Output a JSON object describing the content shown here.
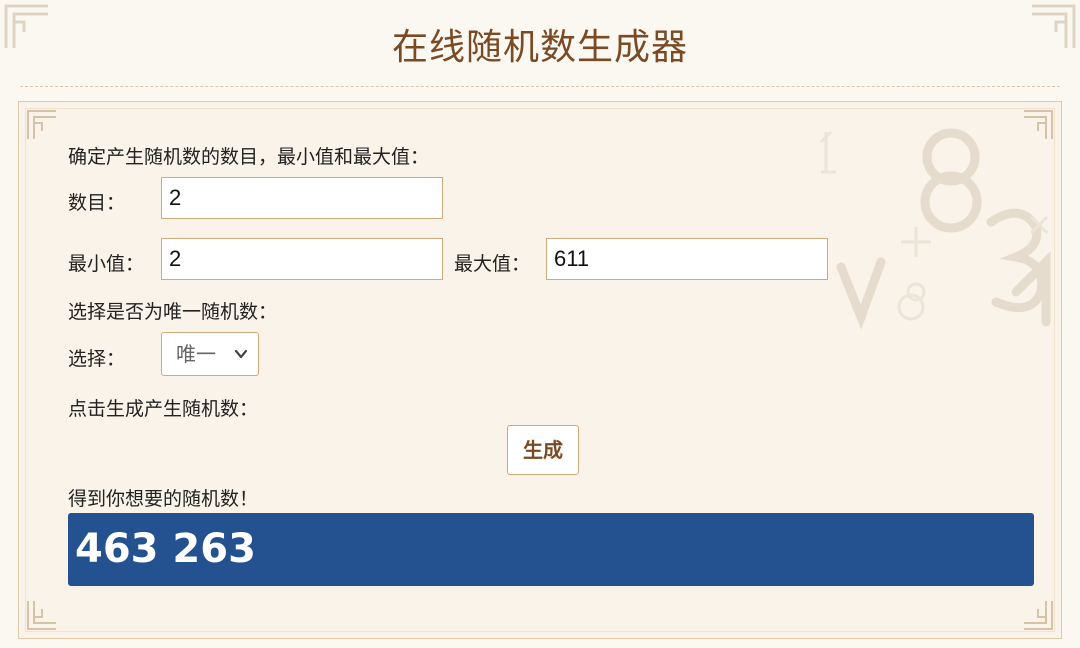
{
  "page": {
    "title": "在线随机数生成器"
  },
  "form": {
    "intro": "确定产生随机数的数目，最小值和最大值：",
    "count_label": "数目：",
    "count_value": "2",
    "min_label": "最小值：",
    "min_value": "2",
    "max_label": "最大值：",
    "max_value": "611",
    "unique_prompt": "选择是否为唯一随机数：",
    "select_label": "选择：",
    "select_value": "唯一",
    "click_prompt": "点击生成产生随机数：",
    "generate_label": "生成",
    "result_label": "得到你想要的随机数！",
    "result_value": "463 263"
  },
  "icons": {
    "select_arrow": "chevron-down-icon",
    "corner": "corner-ornament-icon",
    "background": "numbers-decoration-icon"
  },
  "colors": {
    "title": "#7a4a24",
    "border": "#d3a87c",
    "result_bg": "#24518f",
    "page_bg": "#fbf8f2"
  }
}
